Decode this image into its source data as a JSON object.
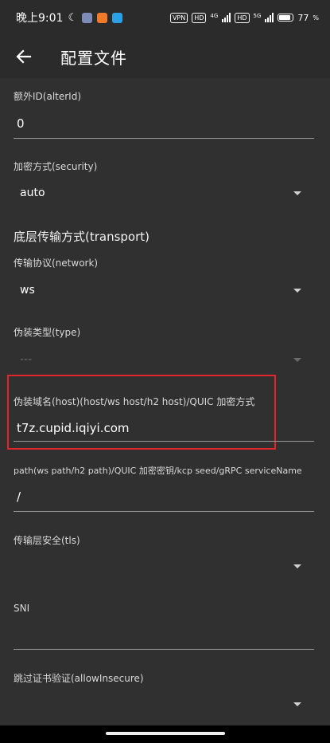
{
  "status": {
    "time": "晚上9:01",
    "vpn": "VPN",
    "hd1": "HD",
    "net1": "4G",
    "hd2": "HD",
    "net2": "5G",
    "battery": "77"
  },
  "app_bar": {
    "title": "配置文件"
  },
  "fields": {
    "alter_id": {
      "label": "额外ID(alterId)",
      "value": "0"
    },
    "security": {
      "label": "加密方式(security)",
      "value": "auto"
    },
    "transport_title": "底层传输方式(transport)",
    "network": {
      "label": "传输协议(network)",
      "value": "ws"
    },
    "header_type": {
      "label": "伪装类型(type)",
      "value": "---"
    },
    "host": {
      "label": "伪装域名(host)(host/ws host/h2 host)/QUIC 加密方式",
      "value": "t7z.cupid.iqiyi.com"
    },
    "path": {
      "label": "path(ws path/h2 path)/QUIC 加密密钥/kcp seed/gRPC serviceName",
      "value": "/"
    },
    "tls": {
      "label": "传输层安全(tls)",
      "value": ""
    },
    "sni": {
      "label": "SNI",
      "value": ""
    },
    "allow_insecure": {
      "label": "跳过证书验证(allowInsecure)",
      "value": ""
    }
  },
  "colors": {
    "highlight": "#e0262d",
    "background": "#303030"
  }
}
